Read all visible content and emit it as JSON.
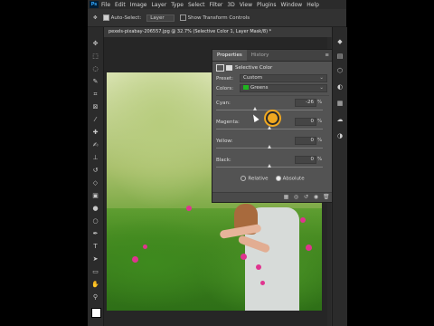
{
  "menubar": {
    "logo": "Ps",
    "items": [
      "File",
      "Edit",
      "Image",
      "Layer",
      "Type",
      "Select",
      "Filter",
      "3D",
      "View",
      "Plugins",
      "Window",
      "Help"
    ]
  },
  "options": {
    "auto_select_label": "Auto-Select:",
    "auto_select_value": "Layer",
    "transform_controls_label": "Show Transform Controls"
  },
  "document": {
    "tab_title": "pexels-pixabay-206557.jpg @ 32.7% (Selective Color 1, Layer Mask/8) *"
  },
  "properties": {
    "tabs": [
      "Properties",
      "History"
    ],
    "adjustment_title": "Selective Color",
    "preset_label": "Preset:",
    "preset_value": "Custom",
    "colors_label": "Colors:",
    "colors_value": "Greens",
    "colors_swatch": "#1fb51f",
    "sliders": [
      {
        "label": "Cyan:",
        "value": -26,
        "display": "-26",
        "unit": "%"
      },
      {
        "label": "Magenta:",
        "value": 0,
        "display": "0",
        "unit": "%"
      },
      {
        "label": "Yellow:",
        "value": 0,
        "display": "0",
        "unit": "%"
      },
      {
        "label": "Black:",
        "value": 0,
        "display": "0",
        "unit": "%"
      }
    ],
    "method_relative": "Relative",
    "method_absolute": "Absolute",
    "selected_method": "Absolute"
  },
  "colors": {
    "highlight": "#f0a820",
    "flower": "#e0348f"
  }
}
